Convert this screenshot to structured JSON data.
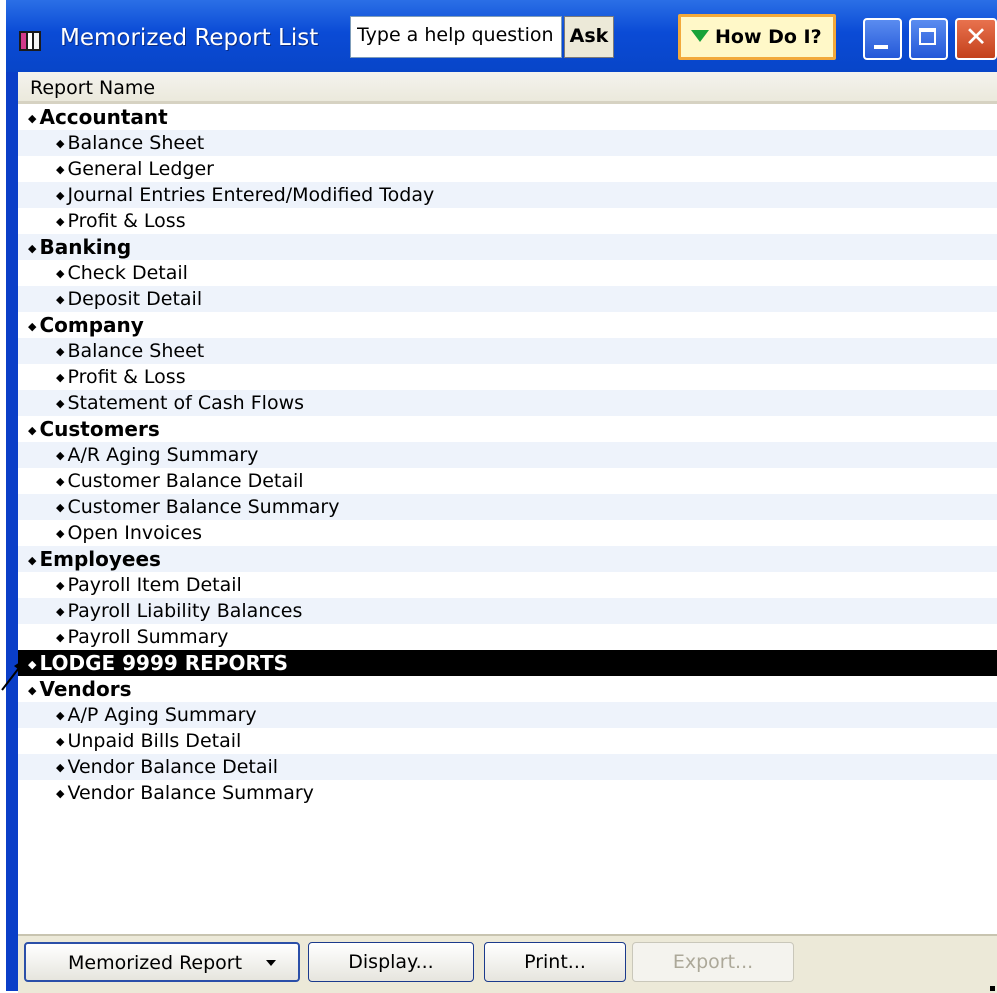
{
  "window": {
    "title": "Memorized Report List",
    "help_placeholder": "Type a help question",
    "ask_label": "Ask",
    "howdoi_label": "How Do I?",
    "close_glyph": "✕"
  },
  "list": {
    "column_header": "Report Name",
    "rows": [
      {
        "type": "cat",
        "label": "Accountant"
      },
      {
        "type": "item",
        "label": "Balance Sheet"
      },
      {
        "type": "item",
        "label": "General Ledger"
      },
      {
        "type": "item",
        "label": "Journal Entries Entered/Modified Today"
      },
      {
        "type": "item",
        "label": "Profit & Loss"
      },
      {
        "type": "cat",
        "label": "Banking"
      },
      {
        "type": "item",
        "label": "Check Detail"
      },
      {
        "type": "item",
        "label": "Deposit Detail"
      },
      {
        "type": "cat",
        "label": "Company"
      },
      {
        "type": "item",
        "label": "Balance Sheet"
      },
      {
        "type": "item",
        "label": "Profit & Loss"
      },
      {
        "type": "item",
        "label": "Statement of Cash Flows"
      },
      {
        "type": "cat",
        "label": "Customers"
      },
      {
        "type": "item",
        "label": "A/R Aging Summary"
      },
      {
        "type": "item",
        "label": "Customer Balance Detail"
      },
      {
        "type": "item",
        "label": "Customer Balance Summary"
      },
      {
        "type": "item",
        "label": "Open Invoices"
      },
      {
        "type": "cat",
        "label": "Employees"
      },
      {
        "type": "item",
        "label": "Payroll Item Detail"
      },
      {
        "type": "item",
        "label": "Payroll Liability Balances"
      },
      {
        "type": "item",
        "label": "Payroll Summary"
      },
      {
        "type": "cat",
        "label": "LODGE 9999 REPORTS",
        "selected": true
      },
      {
        "type": "cat",
        "label": "Vendors"
      },
      {
        "type": "item",
        "label": "A/P Aging Summary"
      },
      {
        "type": "item",
        "label": "Unpaid Bills Detail"
      },
      {
        "type": "item",
        "label": "Vendor Balance Detail"
      },
      {
        "type": "item",
        "label": "Vendor Balance Summary"
      }
    ]
  },
  "buttons": {
    "memorized_report": "Memorized Report",
    "display": "Display...",
    "print": "Print...",
    "export": "Export..."
  },
  "colors": {
    "title_bar": "#0845c8",
    "selected_row": "#000000",
    "alt_row": "#eef3fb",
    "howdoi_border": "#f2a93b"
  },
  "icons": [
    "app-icon",
    "minimize-icon",
    "maximize-icon",
    "close-icon",
    "dropdown-caret-icon",
    "bullet-diamond-icon",
    "arrow-pointer-icon"
  ]
}
